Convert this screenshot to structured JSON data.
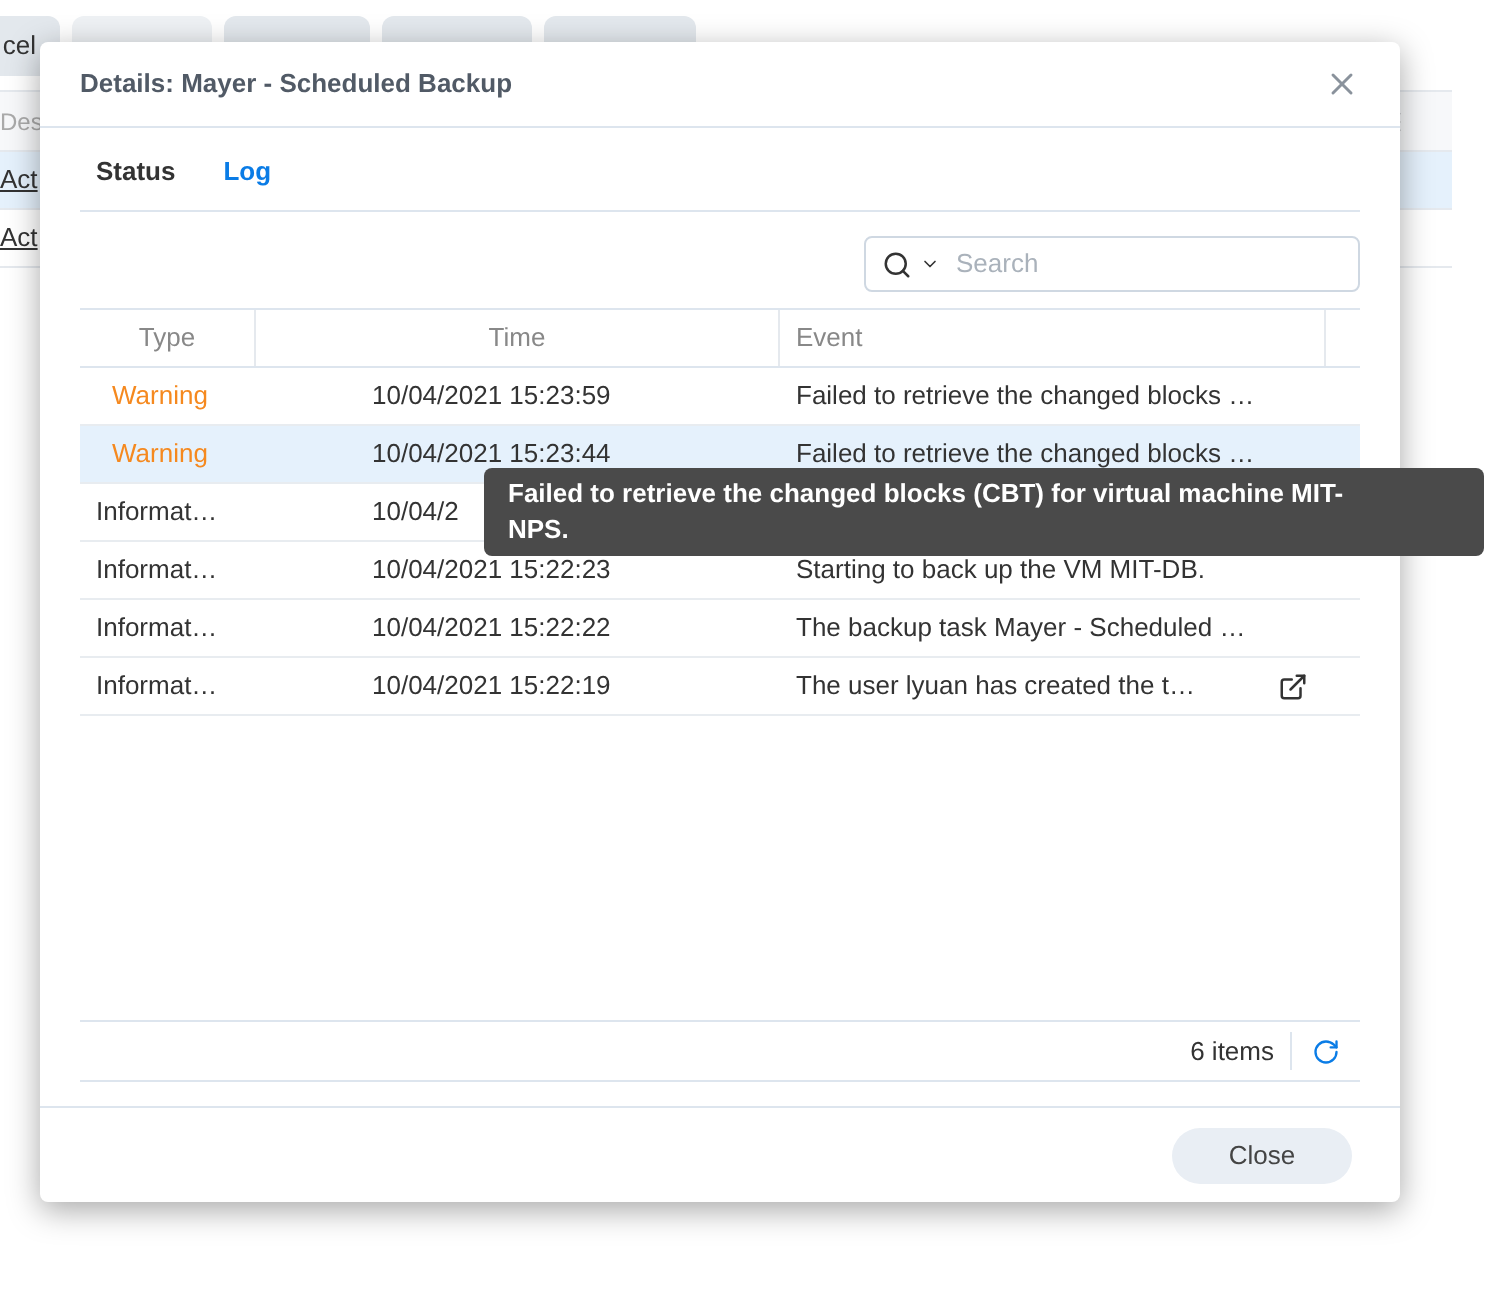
{
  "background": {
    "toolbar_button": "cel",
    "table": {
      "column_1": "Des",
      "rows": [
        {
          "link": "Act",
          "selected": true
        },
        {
          "link": "Act",
          "selected": false
        }
      ]
    }
  },
  "dialog": {
    "title": "Details: Mayer - Scheduled Backup",
    "tabs": [
      {
        "label": "Status",
        "selected": false
      },
      {
        "label": "Log",
        "selected": true
      }
    ],
    "search": {
      "placeholder": "Search"
    },
    "table": {
      "columns": [
        "Type",
        "Time",
        "Event"
      ],
      "rows": [
        {
          "type": "Warning",
          "kind": "warning",
          "time": "10/04/2021 15:23:59",
          "event": "Failed to retrieve the changed blocks …",
          "selected": false,
          "link": false
        },
        {
          "type": "Warning",
          "kind": "warning",
          "time": "10/04/2021 15:23:44",
          "event": "Failed to retrieve the changed blocks …",
          "selected": true,
          "link": false
        },
        {
          "type": "Informat…",
          "kind": "info",
          "time": "10/04/2",
          "selected": false,
          "link": false
        },
        {
          "type": "Informat…",
          "kind": "info",
          "time": "10/04/2021 15:22:23",
          "event": "Starting to back up the VM MIT-DB.",
          "selected": false,
          "link": false
        },
        {
          "type": "Informat…",
          "kind": "info",
          "time": "10/04/2021 15:22:22",
          "event": "The backup task Mayer - Scheduled …",
          "selected": false,
          "link": false
        },
        {
          "type": "Informat…",
          "kind": "info",
          "time": "10/04/2021 15:22:19",
          "event": "The user lyuan has created the t…",
          "selected": false,
          "link": true
        }
      ]
    },
    "tooltip": "Failed to retrieve the changed blocks (CBT) for virtual machine MIT-NPS.",
    "count": "6 items",
    "close_button": "Close"
  }
}
